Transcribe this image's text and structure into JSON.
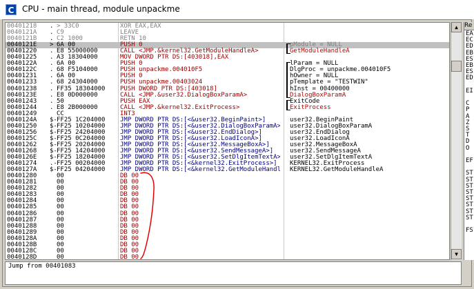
{
  "window": {
    "title": "CPU - main thread, module unpackme",
    "icon_letter": "C",
    "icon_name": "cpu-window-icon"
  },
  "disasm": {
    "rows": [
      {
        "addr": "00401218",
        "mark": ".",
        "hex": "> 33C0",
        "dis": "XOR EAX,EAX",
        "com": ""
      },
      {
        "addr": "0040121A",
        "mark": ".",
        "hex": "C9",
        "dis": "LEAVE",
        "com": ""
      },
      {
        "addr": "0040121B",
        "mark": ".",
        "hex": "C2 1000",
        "dis": "RETN 10",
        "com": ""
      },
      {
        "addr": "0040121E",
        "mark": ">",
        "hex": "6A 00",
        "dis": "PUSH 0",
        "com": "pModule = NULL"
      },
      {
        "addr": "00401220",
        "mark": ".",
        "hex": "E8 55000000",
        "dis": "CALL <JMP.&kernel32.GetModuleHandleA>",
        "com": "GetModuleHandleA"
      },
      {
        "addr": "00401225",
        "mark": ".",
        "hex": "A3 18304000",
        "dis": "MOV DWORD PTR DS:[403018],EAX",
        "com": ""
      },
      {
        "addr": "0040122A",
        "mark": ".",
        "hex": "6A 00",
        "dis": "PUSH 0",
        "com": "lParam = NULL"
      },
      {
        "addr": "0040122C",
        "mark": ".",
        "hex": "68 F5104000",
        "dis": "PUSH unpackme.004010F5",
        "com": "DlgProc = unpackme.004010F5"
      },
      {
        "addr": "00401231",
        "mark": ".",
        "hex": "6A 00",
        "dis": "PUSH 0",
        "com": "hOwner = NULL"
      },
      {
        "addr": "00401233",
        "mark": ".",
        "hex": "68 24304000",
        "dis": "PUSH unpackme.00403024",
        "com": "pTemplate = \"TESTWIN\""
      },
      {
        "addr": "00401238",
        "mark": ".",
        "hex": "FF35 18304000",
        "dis": "PUSH DWORD PTR DS:[403018]",
        "com": "hInst = 00400000"
      },
      {
        "addr": "0040123E",
        "mark": ".",
        "hex": "E8 0D000000",
        "dis": "CALL <JMP.&user32.DialogBoxParamA>",
        "com": "DialogBoxParamA"
      },
      {
        "addr": "00401243",
        "mark": ".",
        "hex": "50",
        "dis": "PUSH EAX",
        "com": "ExitCode"
      },
      {
        "addr": "00401244",
        "mark": ".",
        "hex": "E8 2B000000",
        "dis": "CALL <JMP.&kernel32.ExitProcess>",
        "com": "ExitProcess"
      },
      {
        "addr": "00401249",
        "mark": "",
        "hex": "CC",
        "dis": "INT3",
        "com": ""
      },
      {
        "addr": "0040124A",
        "mark": "$-",
        "hex": "FF25 1C204000",
        "dis": "JMP DWORD PTR DS:[<&user32.BeginPaint>]",
        "com": "user32.BeginPaint"
      },
      {
        "addr": "00401250",
        "mark": "$-",
        "hex": "FF25 10204000",
        "dis": "JMP DWORD PTR DS:[<&user32.DialogBoxParamA>]",
        "com": "user32.DialogBoxParamA"
      },
      {
        "addr": "00401256",
        "mark": "$-",
        "hex": "FF25 24204000",
        "dis": "JMP DWORD PTR DS:[<&user32.EndDialog>]",
        "com": "user32.EndDialog"
      },
      {
        "addr": "0040125C",
        "mark": "$-",
        "hex": "FF25 0C204000",
        "dis": "JMP DWORD PTR DS:[<&user32.LoadIconA>]",
        "com": "user32.LoadIconA"
      },
      {
        "addr": "00401262",
        "mark": "$-",
        "hex": "FF25 20204000",
        "dis": "JMP DWORD PTR DS:[<&user32.MessageBoxA>]",
        "com": "user32.MessageBoxA"
      },
      {
        "addr": "00401268",
        "mark": "$-",
        "hex": "FF25 14204000",
        "dis": "JMP DWORD PTR DS:[<&user32.SendMessageA>]",
        "com": "user32.SendMessageA"
      },
      {
        "addr": "0040126E",
        "mark": "$-",
        "hex": "FF25 18204000",
        "dis": "JMP DWORD PTR DS:[<&user32.SetDlgItemTextA>]",
        "com": "user32.SetDlgItemTextA"
      },
      {
        "addr": "00401274",
        "mark": ".-",
        "hex": "FF25 00204000",
        "dis": "JMP DWORD PTR DS:[<&kernel32.ExitProcess>]",
        "com": "KERNEL32.ExitProcess"
      },
      {
        "addr": "0040127A",
        "mark": "$-",
        "hex": "FF25 04204000",
        "dis": "JMP DWORD PTR DS:[<&kernel32.GetModuleHandleA>]",
        "com": "KERNEL32.GetModuleHandleA"
      },
      {
        "addr": "00401280",
        "mark": "",
        "hex": "00",
        "dis": "DB 00",
        "com": ""
      },
      {
        "addr": "00401281",
        "mark": "",
        "hex": "00",
        "dis": "DB 00",
        "com": ""
      },
      {
        "addr": "00401282",
        "mark": "",
        "hex": "00",
        "dis": "DB 00",
        "com": ""
      },
      {
        "addr": "00401283",
        "mark": "",
        "hex": "00",
        "dis": "DB 00",
        "com": ""
      },
      {
        "addr": "00401284",
        "mark": "",
        "hex": "00",
        "dis": "DB 00",
        "com": ""
      },
      {
        "addr": "00401285",
        "mark": "",
        "hex": "00",
        "dis": "DB 00",
        "com": ""
      },
      {
        "addr": "00401286",
        "mark": "",
        "hex": "00",
        "dis": "DB 00",
        "com": ""
      },
      {
        "addr": "00401287",
        "mark": "",
        "hex": "00",
        "dis": "DB 00",
        "com": ""
      },
      {
        "addr": "00401288",
        "mark": "",
        "hex": "00",
        "dis": "DB 00",
        "com": ""
      },
      {
        "addr": "00401289",
        "mark": "",
        "hex": "00",
        "dis": "DB 00",
        "com": ""
      },
      {
        "addr": "0040128A",
        "mark": "",
        "hex": "00",
        "dis": "DB 00",
        "com": ""
      },
      {
        "addr": "0040128B",
        "mark": "",
        "hex": "00",
        "dis": "DB 00",
        "com": ""
      },
      {
        "addr": "0040128C",
        "mark": "",
        "hex": "00",
        "dis": "DB 00",
        "com": ""
      },
      {
        "addr": "0040128D",
        "mark": "",
        "hex": "00",
        "dis": "DB 00",
        "com": ""
      }
    ]
  },
  "registers": {
    "header": "Re",
    "labels": [
      "EA",
      "EC",
      "ED",
      "EB",
      "ES",
      "EB",
      "ES",
      "ED",
      "",
      "EI",
      "",
      "C",
      "P",
      "A",
      "Z",
      "S",
      "T",
      "D",
      "O",
      "",
      "EF",
      "",
      "ST",
      "ST",
      "ST",
      "ST",
      "ST",
      "ST",
      "ST",
      "ST",
      "",
      "FS"
    ]
  },
  "info": {
    "text": "Jump from 00401083"
  },
  "scrollbar": {
    "up_icon": "scroll-up-arrow-icon",
    "down_icon": "scroll-down-arrow-icon"
  },
  "colors": {
    "call_comment": "#c00000",
    "jump_text": "#000080",
    "selection": "#c0c0c0",
    "annotation": "#e00000"
  }
}
